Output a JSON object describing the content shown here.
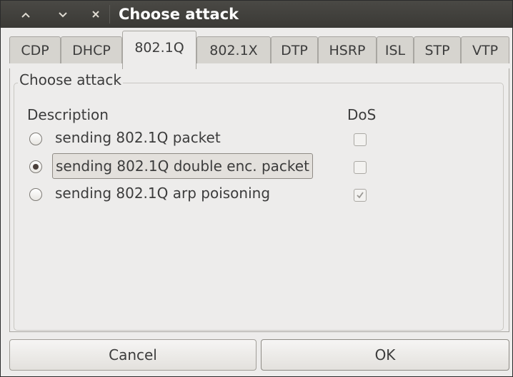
{
  "window": {
    "title": "Choose attack"
  },
  "titlebar": {
    "buttons": [
      "minimize-icon",
      "maximize-icon",
      "close-icon"
    ]
  },
  "tabs": [
    {
      "label": "CDP",
      "active": false
    },
    {
      "label": "DHCP",
      "active": false
    },
    {
      "label": "802.1Q",
      "active": true
    },
    {
      "label": "802.1X",
      "active": false
    },
    {
      "label": "DTP",
      "active": false
    },
    {
      "label": "HSRP",
      "active": false
    },
    {
      "label": "ISL",
      "active": false
    },
    {
      "label": "STP",
      "active": false
    },
    {
      "label": "VTP",
      "active": false
    }
  ],
  "attack_frame": {
    "label": "Choose attack",
    "col_description": "Description",
    "col_dos": "DoS",
    "attacks": [
      {
        "label": "sending 802.1Q packet",
        "selected": false,
        "dos": false
      },
      {
        "label": "sending 802.1Q double enc. packet",
        "selected": true,
        "dos": false
      },
      {
        "label": "sending 802.1Q arp poisoning",
        "selected": false,
        "dos": true
      }
    ]
  },
  "buttons": {
    "cancel": "Cancel",
    "ok": "OK"
  },
  "colors": {
    "titlebar": "#3c3b37",
    "window_bg": "#edeceb",
    "text": "#3c3c3c"
  }
}
